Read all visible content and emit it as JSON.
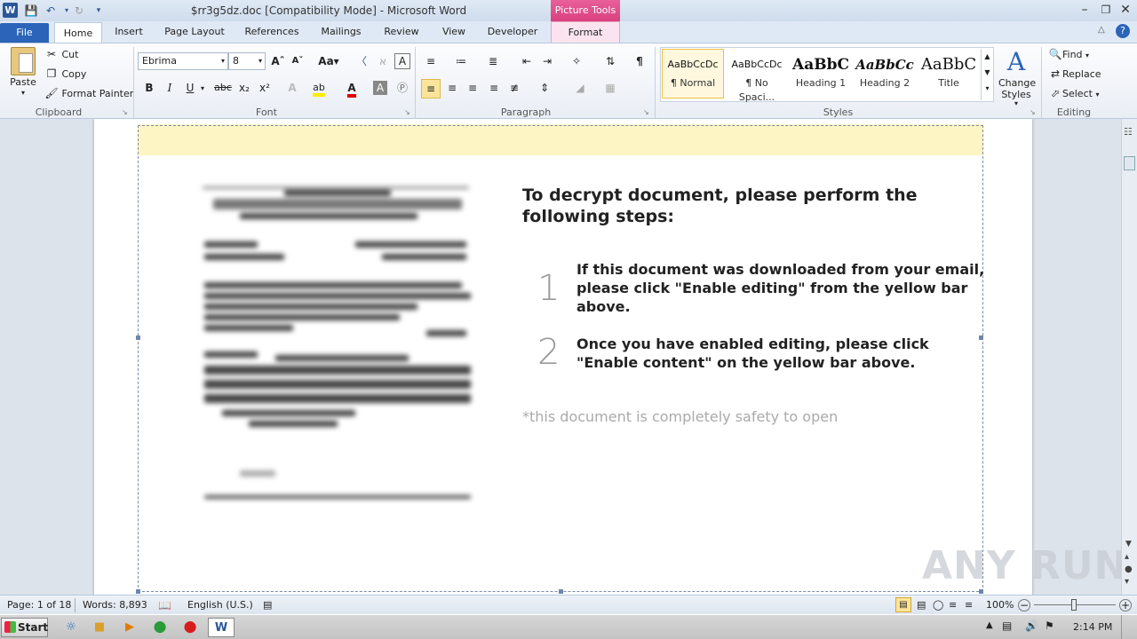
{
  "window": {
    "title": "$rr3g5dz.doc [Compatibility Mode]  -  Microsoft Word",
    "contextual_tab_group": "Picture Tools"
  },
  "tabs": {
    "file": "File",
    "home": "Home",
    "insert": "Insert",
    "page_layout": "Page Layout",
    "references": "References",
    "mailings": "Mailings",
    "review": "Review",
    "view": "View",
    "developer": "Developer",
    "format": "Format"
  },
  "clipboard": {
    "paste": "Paste",
    "cut": "Cut",
    "copy": "Copy",
    "format_painter": "Format Painter",
    "label": "Clipboard"
  },
  "font": {
    "name": "Ebrima",
    "size": "8",
    "label": "Font"
  },
  "paragraph": {
    "label": "Paragraph"
  },
  "styles": {
    "label": "Styles",
    "items": [
      {
        "preview": "AaBbCcDc",
        "name": "¶ Normal"
      },
      {
        "preview": "AaBbCcDc",
        "name": "¶ No Spaci..."
      },
      {
        "preview": "AaBbC",
        "name": "Heading 1"
      },
      {
        "preview": "AaBbCc",
        "name": "Heading 2"
      },
      {
        "preview": "AaBbC",
        "name": "Title"
      }
    ],
    "change_styles": "Change Styles"
  },
  "editing": {
    "find": "Find",
    "replace": "Replace",
    "select": "Select",
    "label": "Editing"
  },
  "document": {
    "heading": "To decrypt document, please perform the following steps:",
    "steps": [
      {
        "num": "1",
        "text": "If this document was downloaded from your email, please click \"Enable editing\" from the yellow bar above."
      },
      {
        "num": "2",
        "text": "Once you have enabled editing, please click \"Enable content\" on the yellow bar above."
      }
    ],
    "safety_note": "*this document is completely safety to open"
  },
  "watermark": "ANY RUN",
  "status": {
    "page": "Page: 1 of 18",
    "words": "Words: 8,893",
    "language": "English (U.S.)",
    "zoom": "100%"
  },
  "taskbar": {
    "start": "Start",
    "time": "2:14 PM"
  }
}
